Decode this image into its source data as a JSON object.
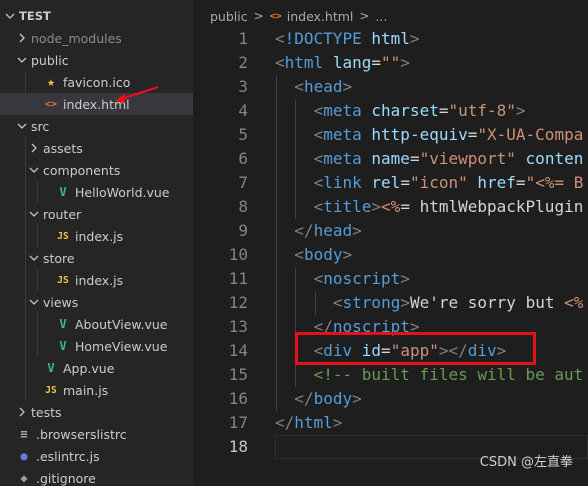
{
  "explorer": {
    "root": "TEST",
    "items": [
      {
        "label": "node_modules",
        "kind": "folder",
        "depth": 1,
        "expanded": false,
        "muted": true,
        "icon": ""
      },
      {
        "label": "public",
        "kind": "folder",
        "depth": 1,
        "expanded": true,
        "icon": ""
      },
      {
        "label": "favicon.ico",
        "kind": "file",
        "depth": 2,
        "icon": "star-icon",
        "glyph": "★"
      },
      {
        "label": "index.html",
        "kind": "file",
        "depth": 2,
        "icon": "html-icon",
        "glyph": "<>",
        "selected": true
      },
      {
        "label": "src",
        "kind": "folder",
        "depth": 1,
        "expanded": true,
        "icon": ""
      },
      {
        "label": "assets",
        "kind": "folder",
        "depth": 2,
        "expanded": false,
        "icon": ""
      },
      {
        "label": "components",
        "kind": "folder",
        "depth": 2,
        "expanded": true,
        "icon": ""
      },
      {
        "label": "HelloWorld.vue",
        "kind": "file",
        "depth": 3,
        "icon": "vue-icon",
        "glyph": "V"
      },
      {
        "label": "router",
        "kind": "folder",
        "depth": 2,
        "expanded": true,
        "icon": ""
      },
      {
        "label": "index.js",
        "kind": "file",
        "depth": 3,
        "icon": "js-icon",
        "glyph": "JS"
      },
      {
        "label": "store",
        "kind": "folder",
        "depth": 2,
        "expanded": true,
        "icon": ""
      },
      {
        "label": "index.js",
        "kind": "file",
        "depth": 3,
        "icon": "js-icon",
        "glyph": "JS"
      },
      {
        "label": "views",
        "kind": "folder",
        "depth": 2,
        "expanded": true,
        "icon": ""
      },
      {
        "label": "AboutView.vue",
        "kind": "file",
        "depth": 3,
        "icon": "vue-icon",
        "glyph": "V"
      },
      {
        "label": "HomeView.vue",
        "kind": "file",
        "depth": 3,
        "icon": "vue-icon",
        "glyph": "V"
      },
      {
        "label": "App.vue",
        "kind": "file",
        "depth": 2,
        "icon": "vue-icon",
        "glyph": "V"
      },
      {
        "label": "main.js",
        "kind": "file",
        "depth": 2,
        "icon": "js-icon",
        "glyph": "JS"
      },
      {
        "label": "tests",
        "kind": "folder",
        "depth": 1,
        "expanded": false,
        "icon": ""
      },
      {
        "label": ".browserslistrc",
        "kind": "file",
        "depth": 1,
        "icon": "list-icon",
        "glyph": "≡"
      },
      {
        "label": ".eslintrc.js",
        "kind": "file",
        "depth": 1,
        "icon": "eslint-icon",
        "glyph": "●"
      },
      {
        "label": ".gitignore",
        "kind": "file",
        "depth": 1,
        "icon": "git-icon",
        "glyph": "◆"
      }
    ]
  },
  "breadcrumb": {
    "folder": "public",
    "sep": ">",
    "file_glyph": "<>",
    "file": "index.html",
    "more": "..."
  },
  "editor": {
    "active_line": 18,
    "lines": [
      {
        "n": "1",
        "indent": 0,
        "parts": [
          [
            "br",
            "<"
          ],
          [
            "doct",
            "!DOCTYPE"
          ],
          [
            "txt",
            " "
          ],
          [
            "attr",
            "html"
          ],
          [
            "br",
            ">"
          ]
        ]
      },
      {
        "n": "2",
        "indent": 0,
        "parts": [
          [
            "br",
            "<"
          ],
          [
            "tag",
            "html"
          ],
          [
            "txt",
            " "
          ],
          [
            "attr",
            "lang"
          ],
          [
            "txt",
            "="
          ],
          [
            "str",
            "\"\""
          ],
          [
            "br",
            ">"
          ]
        ]
      },
      {
        "n": "3",
        "indent": 1,
        "parts": [
          [
            "br",
            "<"
          ],
          [
            "tag",
            "head"
          ],
          [
            "br",
            ">"
          ]
        ]
      },
      {
        "n": "4",
        "indent": 2,
        "parts": [
          [
            "br",
            "<"
          ],
          [
            "tag",
            "meta"
          ],
          [
            "txt",
            " "
          ],
          [
            "attr",
            "charset"
          ],
          [
            "txt",
            "="
          ],
          [
            "str",
            "\"utf-8\""
          ],
          [
            "br",
            ">"
          ]
        ]
      },
      {
        "n": "5",
        "indent": 2,
        "parts": [
          [
            "br",
            "<"
          ],
          [
            "tag",
            "meta"
          ],
          [
            "txt",
            " "
          ],
          [
            "attr",
            "http-equiv"
          ],
          [
            "txt",
            "="
          ],
          [
            "str",
            "\"X-UA-Compa"
          ]
        ]
      },
      {
        "n": "6",
        "indent": 2,
        "parts": [
          [
            "br",
            "<"
          ],
          [
            "tag",
            "meta"
          ],
          [
            "txt",
            " "
          ],
          [
            "attr",
            "name"
          ],
          [
            "txt",
            "="
          ],
          [
            "str",
            "\"viewport\""
          ],
          [
            "txt",
            " "
          ],
          [
            "attr",
            "conten"
          ]
        ]
      },
      {
        "n": "7",
        "indent": 2,
        "parts": [
          [
            "br",
            "<"
          ],
          [
            "tag",
            "link"
          ],
          [
            "txt",
            " "
          ],
          [
            "attr",
            "rel"
          ],
          [
            "txt",
            "="
          ],
          [
            "str",
            "\"icon\""
          ],
          [
            "txt",
            " "
          ],
          [
            "attr",
            "href"
          ],
          [
            "txt",
            "="
          ],
          [
            "str",
            "\"<%= B"
          ]
        ]
      },
      {
        "n": "8",
        "indent": 2,
        "parts": [
          [
            "br",
            "<"
          ],
          [
            "tag",
            "title"
          ],
          [
            "br",
            ">"
          ],
          [
            "ejs",
            "<%"
          ],
          [
            "txt",
            "= htmlWebpackPlugin"
          ]
        ]
      },
      {
        "n": "9",
        "indent": 1,
        "parts": [
          [
            "br",
            "</"
          ],
          [
            "tag",
            "head"
          ],
          [
            "br",
            ">"
          ]
        ]
      },
      {
        "n": "10",
        "indent": 1,
        "parts": [
          [
            "br",
            "<"
          ],
          [
            "tag",
            "body"
          ],
          [
            "br",
            ">"
          ]
        ]
      },
      {
        "n": "11",
        "indent": 2,
        "parts": [
          [
            "br",
            "<"
          ],
          [
            "tag",
            "noscript"
          ],
          [
            "br",
            ">"
          ]
        ]
      },
      {
        "n": "12",
        "indent": 3,
        "parts": [
          [
            "br",
            "<"
          ],
          [
            "tag",
            "strong"
          ],
          [
            "br",
            ">"
          ],
          [
            "txt",
            "We're sorry but "
          ],
          [
            "ejs",
            "<%"
          ]
        ]
      },
      {
        "n": "13",
        "indent": 2,
        "parts": [
          [
            "br",
            "</"
          ],
          [
            "tag",
            "noscript"
          ],
          [
            "br",
            ">"
          ]
        ]
      },
      {
        "n": "14",
        "indent": 2,
        "parts": [
          [
            "br",
            "<"
          ],
          [
            "tag",
            "div"
          ],
          [
            "txt",
            " "
          ],
          [
            "attr",
            "id"
          ],
          [
            "txt",
            "="
          ],
          [
            "str",
            "\"app\""
          ],
          [
            "br",
            "></"
          ],
          [
            "tag",
            "div"
          ],
          [
            "br",
            ">"
          ]
        ]
      },
      {
        "n": "15",
        "indent": 2,
        "parts": [
          [
            "com",
            "<!-- built files will be aut"
          ]
        ]
      },
      {
        "n": "16",
        "indent": 1,
        "parts": [
          [
            "br",
            "</"
          ],
          [
            "tag",
            "body"
          ],
          [
            "br",
            ">"
          ]
        ]
      },
      {
        "n": "17",
        "indent": 0,
        "parts": [
          [
            "br",
            "</"
          ],
          [
            "tag",
            "html"
          ],
          [
            "br",
            ">"
          ]
        ]
      },
      {
        "n": "18",
        "indent": 0,
        "parts": []
      }
    ]
  },
  "annotations": {
    "highlight": "red-box",
    "arrow_color": "#e3111a"
  },
  "watermark": "CSDN @左直拳",
  "colors": {
    "sidebar_bg": "#252526",
    "editor_bg": "#1e1e1e",
    "selected_row": "#37373d",
    "tag": "#569cd6",
    "attr": "#9cdcfe",
    "string": "#ce9178",
    "comment": "#6a9955",
    "bracket": "#808080",
    "annotation_red": "#e3111a"
  }
}
